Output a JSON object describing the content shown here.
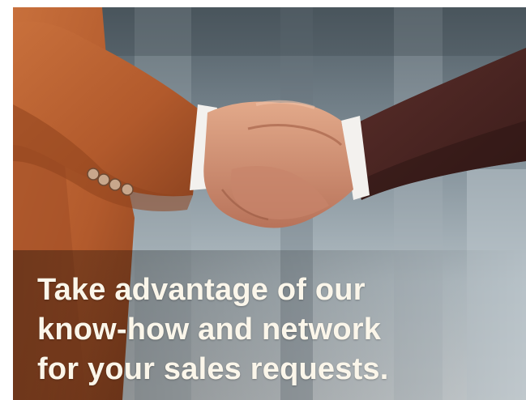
{
  "headline": {
    "line1": "Take advantage of our",
    "line2": "know-how and network",
    "line3": "for your sales requests."
  },
  "colors": {
    "headline_text": "#fbf6ea",
    "left_sleeve": "#b85f30",
    "right_sleeve": "#4a2622",
    "background": "#8a979f"
  }
}
